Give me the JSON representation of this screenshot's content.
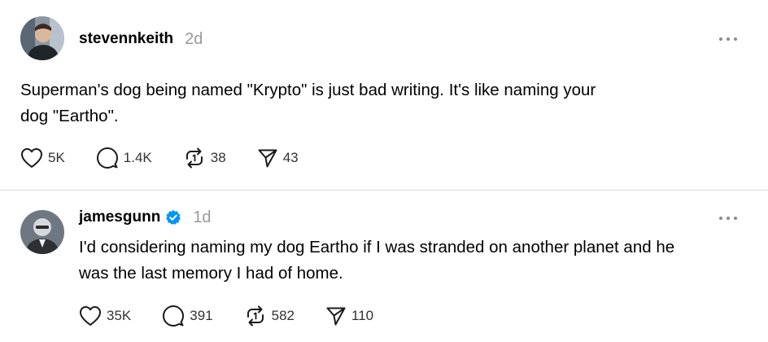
{
  "posts": [
    {
      "username": "stevennkeith",
      "time": "2d",
      "verified": false,
      "text": "Superman's dog being named \"Krypto\" is just bad writing. It's like naming your\ndog \"Eartho\".",
      "likes": "5K",
      "replies": "1.4K",
      "reposts": "38",
      "shares": "43"
    },
    {
      "username": "jamesgunn",
      "time": "1d",
      "verified": true,
      "text": "I'd considering naming my dog Eartho if I was stranded on another planet and he\nwas the last memory I had of home.",
      "likes": "35K",
      "replies": "391",
      "reposts": "582",
      "shares": "110"
    }
  ],
  "colors": {
    "verified": "#0095f6",
    "muted": "#999999",
    "divider": "#dedede"
  },
  "icons": {
    "like": "heart-icon",
    "reply": "comment-icon",
    "repost": "repost-icon",
    "share": "send-icon",
    "more": "more-horizontal-icon",
    "verified": "verified-badge-icon"
  }
}
